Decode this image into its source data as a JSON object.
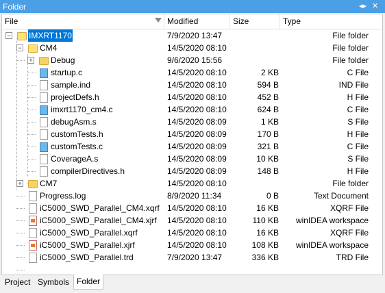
{
  "window": {
    "title": "Folder",
    "pin_icon": "pin-icon",
    "close_icon": "close-icon"
  },
  "columns": {
    "file": "File",
    "modified": "Modified",
    "size": "Size",
    "type": "Type"
  },
  "rows": [
    {
      "name": "IMXRT1170",
      "modified": "7/9/2020 13:47",
      "size": "",
      "type": "File folder",
      "icon": "folder-icon",
      "selected": true
    },
    {
      "name": "CM4",
      "modified": "14/5/2020 08:10",
      "size": "",
      "type": "File folder",
      "icon": "folder-icon"
    },
    {
      "name": "Debug",
      "modified": "9/6/2020 15:56",
      "size": "",
      "type": "File folder",
      "icon": "folder-icon"
    },
    {
      "name": "startup.c",
      "modified": "14/5/2020 08:10",
      "size": "2 KB",
      "type": "C File",
      "icon": "c-file-icon"
    },
    {
      "name": "sample.ind",
      "modified": "14/5/2020 08:10",
      "size": "594 B",
      "type": "IND File",
      "icon": "file-icon"
    },
    {
      "name": "projectDefs.h",
      "modified": "14/5/2020 08:10",
      "size": "452 B",
      "type": "H File",
      "icon": "file-icon"
    },
    {
      "name": "imxrt1170_cm4.c",
      "modified": "14/5/2020 08:10",
      "size": "624 B",
      "type": "C File",
      "icon": "c-file-icon"
    },
    {
      "name": "debugAsm.s",
      "modified": "14/5/2020 08:09",
      "size": "1 KB",
      "type": "S File",
      "icon": "file-icon"
    },
    {
      "name": "customTests.h",
      "modified": "14/5/2020 08:09",
      "size": "170 B",
      "type": "H File",
      "icon": "file-icon"
    },
    {
      "name": "customTests.c",
      "modified": "14/5/2020 08:09",
      "size": "321 B",
      "type": "C File",
      "icon": "c-file-icon"
    },
    {
      "name": "CoverageA.s",
      "modified": "14/5/2020 08:09",
      "size": "10 KB",
      "type": "S File",
      "icon": "file-icon"
    },
    {
      "name": "compilerDirectives.h",
      "modified": "14/5/2020 08:09",
      "size": "148 B",
      "type": "H File",
      "icon": "file-icon"
    },
    {
      "name": "CM7",
      "modified": "14/5/2020 08:10",
      "size": "",
      "type": "File folder",
      "icon": "folder-icon"
    },
    {
      "name": "Progress.log",
      "modified": "8/9/2020 11:34",
      "size": "0 B",
      "type": "Text Document",
      "icon": "file-icon"
    },
    {
      "name": "iC5000_SWD_Parallel_CM4.xqrf",
      "modified": "14/5/2020 08:10",
      "size": "16 KB",
      "type": "XQRF File",
      "icon": "file-icon"
    },
    {
      "name": "iC5000_SWD_Parallel_CM4.xjrf",
      "modified": "14/5/2020 08:10",
      "size": "110 KB",
      "type": "winIDEA workspace",
      "icon": "workspace-icon"
    },
    {
      "name": "iC5000_SWD_Parallel.xqrf",
      "modified": "14/5/2020 08:10",
      "size": "16 KB",
      "type": "XQRF File",
      "icon": "file-icon"
    },
    {
      "name": "iC5000_SWD_Parallel.xjrf",
      "modified": "14/5/2020 08:10",
      "size": "108 KB",
      "type": "winIDEA workspace",
      "icon": "workspace-icon"
    },
    {
      "name": "iC5000_SWD_Parallel.trd",
      "modified": "7/9/2020 13:47",
      "size": "336 KB",
      "type": "TRD File",
      "icon": "file-icon"
    }
  ],
  "tabs": [
    {
      "label": "Project"
    },
    {
      "label": "Symbols"
    },
    {
      "label": "Folder",
      "active": true
    }
  ]
}
